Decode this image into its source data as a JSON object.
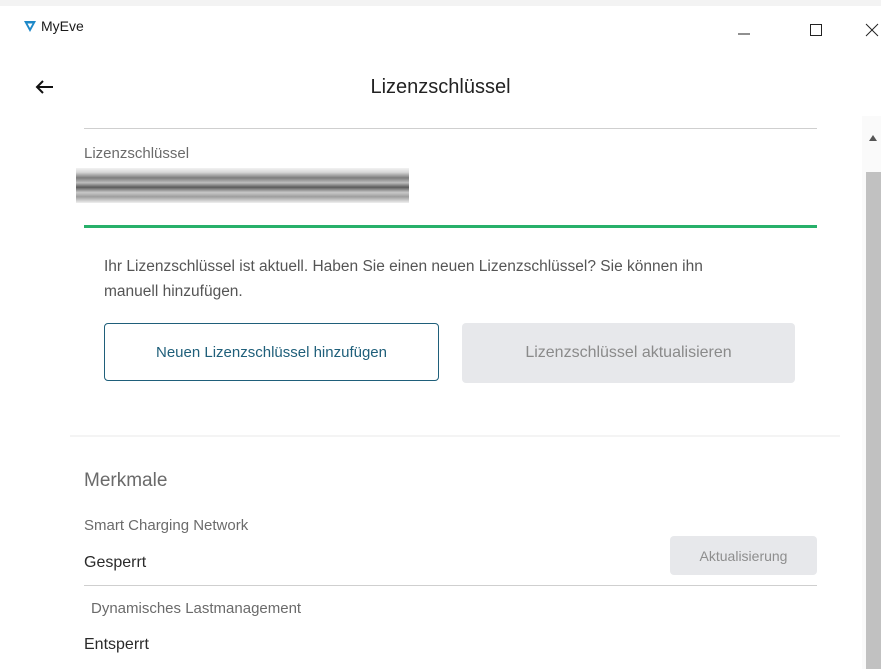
{
  "window": {
    "title": "MyEve",
    "logo_icon": "myeve-logo-icon",
    "minimize_icon": "minimize-icon",
    "maximize_icon": "maximize-icon",
    "close_icon": "close-icon"
  },
  "header": {
    "back_icon": "arrow-left-icon",
    "title": "Lizenzschlüssel"
  },
  "license": {
    "label": "Lizenzschlüssel",
    "info_text": "Ihr Lizenzschlüssel ist aktuell. Haben Sie einen neuen Lizenzschlüssel? Sie können ihn manuell hinzufügen.",
    "add_button": "Neuen Lizenzschlüssel hinzufügen",
    "update_button": "Lizenzschlüssel aktualisieren",
    "status_color": "#27b06a"
  },
  "features": {
    "title": "Merkmale",
    "items": [
      {
        "name": "Smart Charging Network",
        "status": "Gesperrt",
        "action": "Aktualisierung"
      },
      {
        "name": "Dynamisches Lastmanagement",
        "status": "Entsperrt"
      }
    ]
  },
  "colors": {
    "accent": "#1f5f7a",
    "success": "#27b06a",
    "disabled_bg": "#e7e8eb"
  }
}
